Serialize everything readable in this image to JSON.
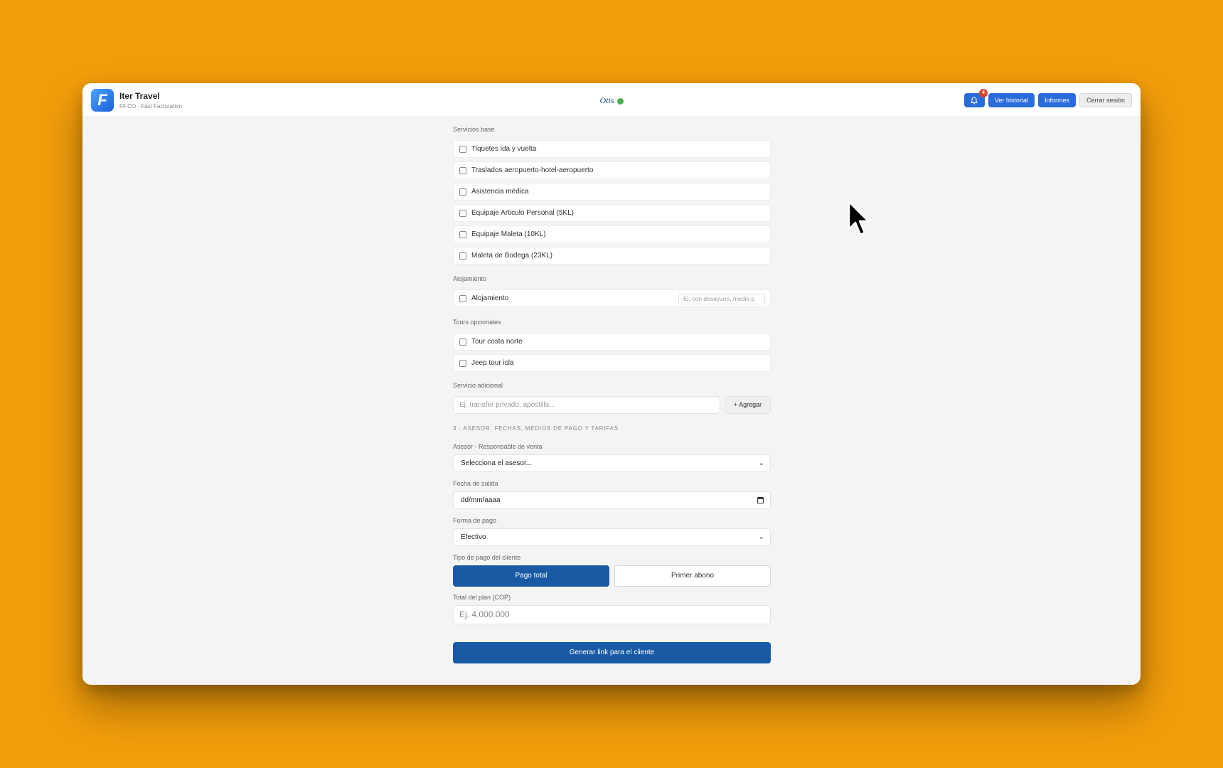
{
  "header": {
    "app_name": "Iter Travel",
    "app_subtitle": "FF.CO · Fast Facturation",
    "logo_letter": "F",
    "center_title": "Otis",
    "notification_count": "4",
    "buttons": {
      "history": "Ver historial",
      "reports": "Informes",
      "logout": "Cerrar sesión"
    },
    "icons": {
      "notifications": "bell-icon",
      "status": "status-dot-icon"
    },
    "colors": {
      "primary": "#2a6bdc",
      "status_dot": "#4caf50",
      "badge": "#d4442e"
    }
  },
  "servicios_base": {
    "label": "Servicios base",
    "items": [
      {
        "label": "Tiquetes ida y vuelta",
        "checked": false
      },
      {
        "label": "Traslados aeropuerto-hotel-aeropuerto",
        "checked": false
      },
      {
        "label": "Asistencia médica",
        "checked": false
      },
      {
        "label": "Equipaje Articulo Personal (5KL)",
        "checked": false
      },
      {
        "label": "Equipaje Maleta (10KL)",
        "checked": false
      },
      {
        "label": "Maleta de Bodega (23KL)",
        "checked": false
      }
    ]
  },
  "alojamiento": {
    "label": "Alojamiento",
    "item_label": "Alojamiento",
    "checked": false,
    "detail_placeholder": "Ej. con desayuno, media p"
  },
  "tours": {
    "label": "Tours opcionales",
    "items": [
      {
        "label": "Tour costa norte",
        "checked": false
      },
      {
        "label": "Jeep tour isla",
        "checked": false
      }
    ]
  },
  "servicio_adicional": {
    "label": "Servicio adicional",
    "placeholder": "Ej. transfer privado, apostilla...",
    "add_button": "+ Agregar"
  },
  "section3": {
    "heading": "3 · ASESOR, FECHAS, MEDIOS DE PAGO Y TARIFAS",
    "asesor_label": "Asesor - Responsable de venta",
    "asesor_value": "Selecciona el asesor...",
    "fecha_label": "Fecha de salida",
    "fecha_value": "dd/mm/aaaa",
    "forma_pago_label": "Forma de pago",
    "forma_pago_value": "Efectivo",
    "tipo_pago_label": "Tipo de pago del cliente",
    "tipo_pago_options": [
      "Pago total",
      "Primer abono"
    ],
    "tipo_pago_selected": "Pago total",
    "total_label": "Total del plan (COP)",
    "total_placeholder": "Ej. 4.000.000",
    "generate_button": "Generar link para el cliente",
    "icons": {
      "select": "chevron-down-icon",
      "date": "calendar-icon"
    },
    "colors": {
      "primary_button": "#1a5aa5"
    }
  },
  "cursor": {
    "icon": "mouse-pointer-icon"
  }
}
